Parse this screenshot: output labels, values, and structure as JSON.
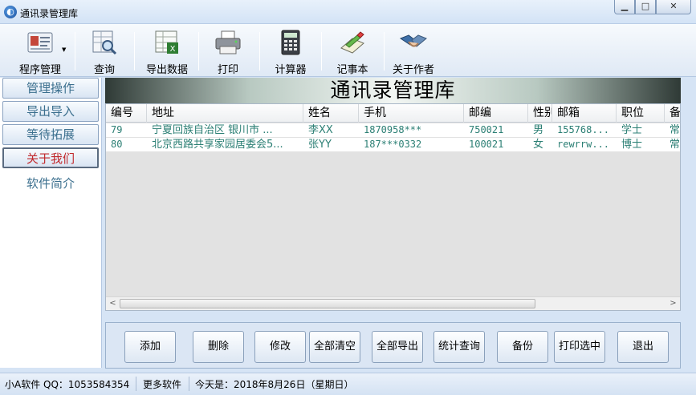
{
  "window": {
    "title": "通讯录管理库",
    "controls": {
      "minimize": "▁",
      "maximize": "□",
      "close": "✕"
    }
  },
  "toolbar": {
    "items": [
      {
        "label": "程序管理",
        "icon": "id-card-icon"
      },
      {
        "label": "查询",
        "icon": "search-query-icon"
      },
      {
        "label": "导出数据",
        "icon": "excel-export-icon"
      },
      {
        "label": "打印",
        "icon": "printer-icon"
      },
      {
        "label": "计算器",
        "icon": "calculator-icon"
      },
      {
        "label": "记事本",
        "icon": "notepad-icon"
      },
      {
        "label": "关于作者",
        "icon": "handshake-icon"
      }
    ],
    "dropdown_arrow": "▼"
  },
  "sidebar": {
    "items": [
      {
        "label": "管理操作"
      },
      {
        "label": "导出导入"
      },
      {
        "label": "等待拓展"
      },
      {
        "label": "关于我们",
        "active": true
      },
      {
        "label": "软件简介"
      }
    ]
  },
  "banner": {
    "title": "通讯录管理库"
  },
  "table": {
    "columns": [
      "编号",
      "地址",
      "姓名",
      "手机",
      "邮编",
      "性别",
      "邮箱",
      "职位",
      "备"
    ],
    "rows": [
      [
        "79",
        "宁夏回族自治区 银川市 ...",
        "李XX",
        "1870958***",
        "750021",
        "男",
        "155768...",
        "学士",
        "常"
      ],
      [
        "80",
        "北京西路共享家园居委会5...",
        "张YY",
        "187***0332",
        "100021",
        "女",
        "rewrrw...",
        "博士",
        "常"
      ]
    ],
    "scroll_left": "<",
    "scroll_right": ">"
  },
  "actions": {
    "buttons": [
      "添加",
      "删除",
      "修改",
      "全部清空",
      "全部导出",
      "统计查询",
      "备份",
      "打印选中",
      "退出"
    ]
  },
  "status": {
    "company": "小A软件 QQ：1053584354",
    "more": "更多软件",
    "today": "今天是：2018年8月26日（星期日）"
  },
  "colors": {
    "accent_text": "#2b7f74",
    "active_nav": "#c0282c",
    "nav_text": "#3b6f8e"
  }
}
